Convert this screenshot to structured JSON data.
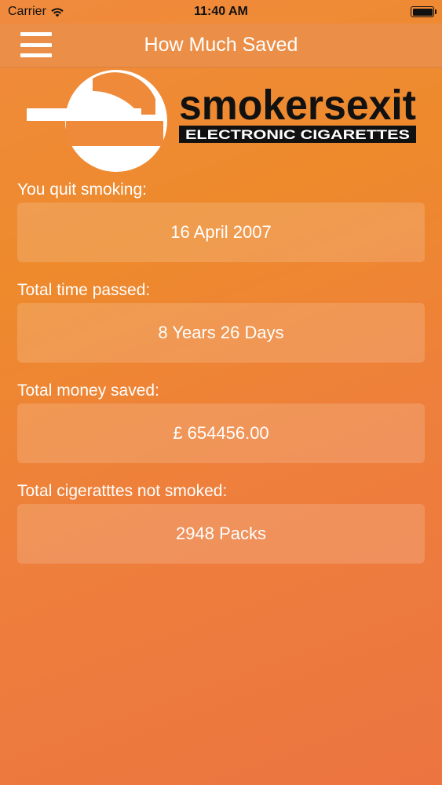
{
  "status_bar": {
    "carrier": "Carrier",
    "time": "11:40 AM"
  },
  "nav": {
    "title": "How Much Saved",
    "menu_icon": "hamburger-icon"
  },
  "logo": {
    "brand_top": "smokersexit",
    "brand_bottom": "ELECTRONIC CIGARETTES"
  },
  "stats": [
    {
      "label": "You quit smoking:",
      "value": "16 April 2007"
    },
    {
      "label": "Total time passed:",
      "value": "8 Years 26 Days"
    },
    {
      "label": "Total money saved:",
      "value": "£ 654456.00"
    },
    {
      "label": "Total cigeratttes not smoked:",
      "value": "2948 Packs"
    }
  ],
  "colors": {
    "background": "#ee8a3a",
    "nav": "#eb8f48",
    "text": "#ffffff"
  }
}
